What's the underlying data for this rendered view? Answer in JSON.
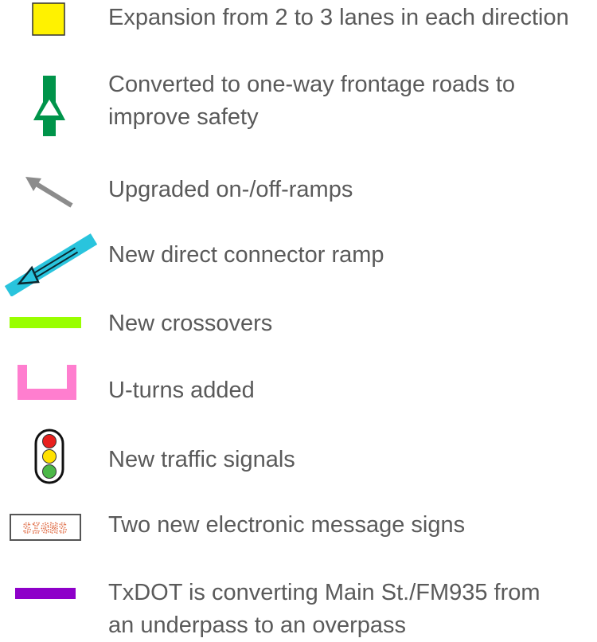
{
  "legend": {
    "items": [
      {
        "icon": "yellow-square-icon",
        "color": "#FFF200",
        "label": "Expansion from 2 to 3 lanes in each direction"
      },
      {
        "icon": "one-way-arrow-icon",
        "color": "#00944A",
        "label": "Converted to one-way frontage roads to\nimprove safety"
      },
      {
        "icon": "gray-arrow-icon",
        "color": "#8C8C8C",
        "label": "Upgraded on-/off-ramps"
      },
      {
        "icon": "connector-ramp-icon",
        "color": "#29C4DD",
        "label": "New direct connector ramp"
      },
      {
        "icon": "green-bar-icon",
        "color": "#99FF00",
        "label": "New crossovers"
      },
      {
        "icon": "u-turn-icon",
        "color": "#FF7ECF",
        "label": "U-turns added"
      },
      {
        "icon": "traffic-signal-icon",
        "colors": [
          "#E8201E",
          "#FFE100",
          "#4CB848"
        ],
        "label": "New traffic signals"
      },
      {
        "icon": "message-sign-icon",
        "icon_text": "SIGNS",
        "color": "#E0704A",
        "label": "Two new electronic message signs"
      },
      {
        "icon": "purple-bar-icon",
        "color": "#8E00C9",
        "label": "TxDOT is converting Main St./FM935 from\nan underpass to an overpass"
      }
    ]
  }
}
